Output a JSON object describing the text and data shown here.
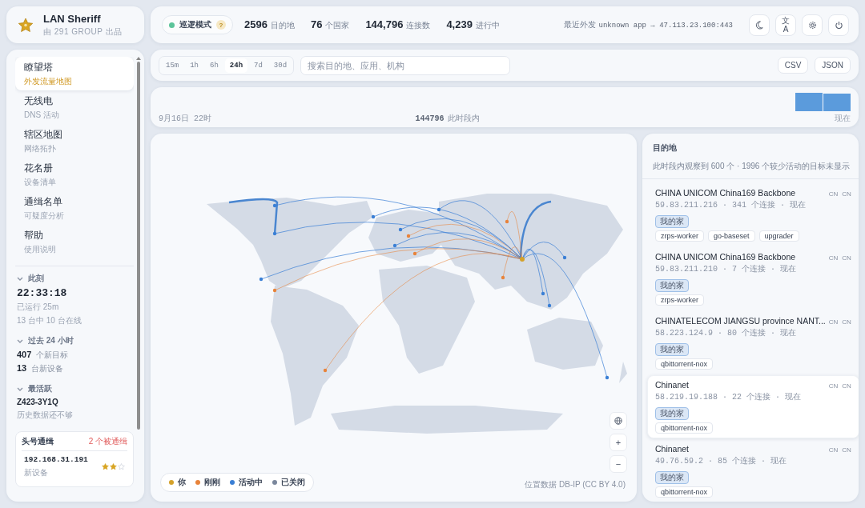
{
  "brand": {
    "title": "LAN Sheriff",
    "subtitle": "由 291 GROUP 出品"
  },
  "topbar": {
    "mode": {
      "label": "巡逻模式",
      "on": true,
      "help": "?"
    },
    "stats": [
      {
        "value": "2596",
        "label": "目的地"
      },
      {
        "value": "76",
        "label": "个国家"
      },
      {
        "value": "144,796",
        "label": "连接数"
      },
      {
        "value": "4,239",
        "label": "进行中"
      }
    ],
    "recent": {
      "label": "最近外发",
      "value": "unknown app → 47.113.23.100:443"
    },
    "lang_button": {
      "top": "文",
      "bottom": "A"
    }
  },
  "sidebar": {
    "nav": [
      {
        "title": "瞭望塔",
        "subtitle": "外发流量地图",
        "selected": true
      },
      {
        "title": "无线电",
        "subtitle": "DNS 活动",
        "selected": false
      },
      {
        "title": "辖区地图",
        "subtitle": "网络拓扑",
        "selected": false
      },
      {
        "title": "花名册",
        "subtitle": "设备清单",
        "selected": false
      },
      {
        "title": "通缉名单",
        "subtitle": "可疑度分析",
        "selected": false
      },
      {
        "title": "帮助",
        "subtitle": "使用说明",
        "selected": false
      }
    ],
    "now": {
      "heading": "此刻",
      "clock": "22:33:18",
      "uptime": "已运行 25m",
      "online": "13 台中 10 台在线"
    },
    "past": {
      "heading": "过去 24 小时",
      "rows": [
        {
          "value": "407",
          "label": "个新目标"
        },
        {
          "value": "13",
          "label": "台新设备"
        }
      ]
    },
    "active": {
      "heading": "最活跃",
      "device": "Z423-3Y1Q",
      "note": "历史数据还不够"
    },
    "wanted": {
      "title": "头号通缉",
      "count": "2 个被通缉",
      "rows": [
        {
          "ip": "192.168.31.191",
          "note": "新设备",
          "stars": 2
        }
      ]
    }
  },
  "toolbar": {
    "ranges": [
      {
        "label": "15m",
        "selected": false
      },
      {
        "label": "1h",
        "selected": false
      },
      {
        "label": "6h",
        "selected": false
      },
      {
        "label": "24h",
        "selected": true
      },
      {
        "label": "7d",
        "selected": false
      },
      {
        "label": "30d",
        "selected": false
      }
    ],
    "search": {
      "placeholder": "搜索目的地、应用、机构"
    },
    "exports": [
      "CSV",
      "JSON"
    ]
  },
  "timeline": {
    "start": "9月16日 22时",
    "total": "144796",
    "total_label": "此时段内",
    "end": "现在"
  },
  "map": {
    "legend": [
      {
        "label": "你",
        "color": "#d4a12a"
      },
      {
        "label": "刚刚",
        "color": "#e8833a"
      },
      {
        "label": "活动中",
        "color": "#3a7fd5"
      },
      {
        "label": "已关闭",
        "color": "#7a879c"
      }
    ],
    "attribution": {
      "prefix": "位置数据",
      "link": "DB-IP",
      "suffix": "(CC BY 4.0)"
    },
    "zoom": [
      "+",
      "−"
    ]
  },
  "destinations": {
    "title": "目的地",
    "summary": "此时段内观察到 600 个 · 1996 个较少活动的目标未显示",
    "items": [
      {
        "name": "CHINA UNICOM China169 Backbone",
        "codes": [
          "CN",
          "CN"
        ],
        "meta": "59.83.211.216 · 341 个连接 · 现在",
        "tag": "我的家",
        "apps": [
          "zrps-worker",
          "go-baseset",
          "upgrader"
        ],
        "selected": false
      },
      {
        "name": "CHINA UNICOM China169 Backbone",
        "codes": [
          "CN",
          "CN"
        ],
        "meta": "59.83.211.210 · 7 个连接 · 现在",
        "tag": "我的家",
        "apps": [
          "zrps-worker"
        ],
        "selected": false
      },
      {
        "name": "CHINATELECOM JIANGSU province NANT...",
        "codes": [
          "CN",
          "CN"
        ],
        "meta": "58.223.124.9 · 80 个连接 · 现在",
        "tag": "我的家",
        "apps": [
          "qbittorrent-nox"
        ],
        "selected": false
      },
      {
        "name": "Chinanet",
        "codes": [
          "CN",
          "CN"
        ],
        "meta": "58.219.19.188 · 22 个连接 · 现在",
        "tag": "我的家",
        "apps": [
          "qbittorrent-nox"
        ],
        "selected": true
      },
      {
        "name": "Chinanet",
        "codes": [
          "CN",
          "CN"
        ],
        "meta": "49.76.59.2 · 85 个连接 · 现在",
        "tag": "我的家",
        "apps": [
          "qbittorrent-nox"
        ],
        "selected": false
      }
    ]
  }
}
